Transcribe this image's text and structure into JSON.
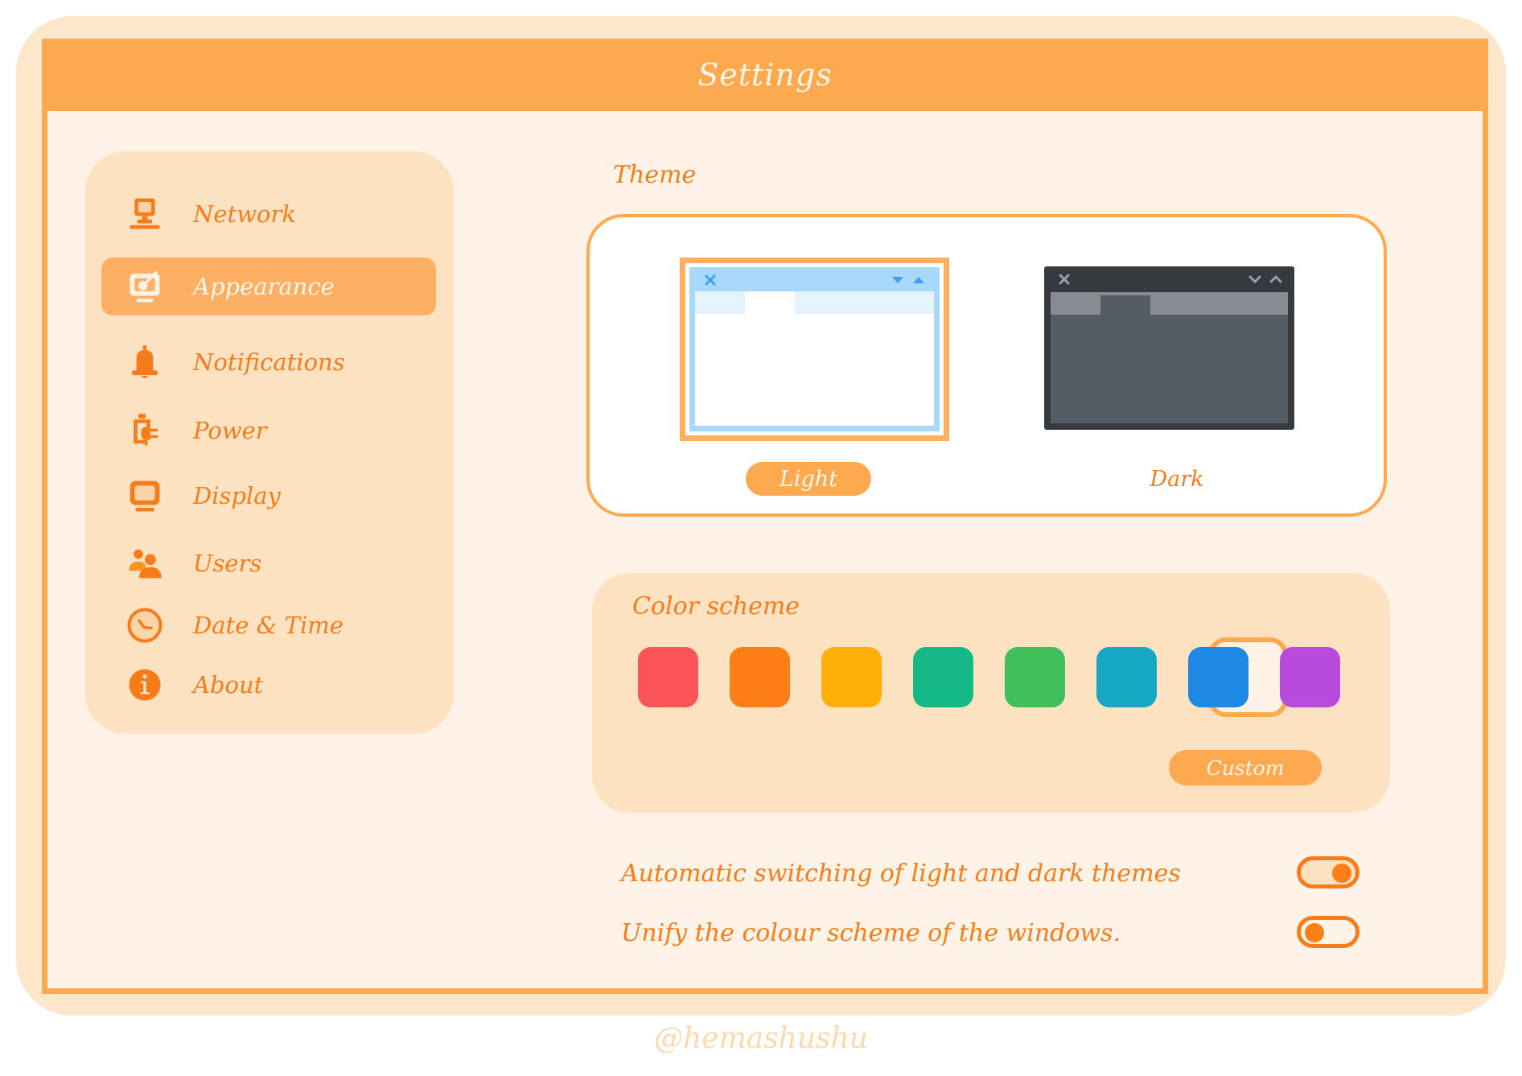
{
  "window": {
    "title": "Settings"
  },
  "sidebar": {
    "items": [
      {
        "label": "Network",
        "icon": "network-computer-icon",
        "active": false
      },
      {
        "label": "Appearance",
        "icon": "appearance-monitor-brush-icon",
        "active": true
      },
      {
        "label": "Notifications",
        "icon": "bell-icon",
        "active": false
      },
      {
        "label": "Power",
        "icon": "battery-plug-icon",
        "active": false
      },
      {
        "label": "Display",
        "icon": "monitor-icon",
        "active": false
      },
      {
        "label": "Users",
        "icon": "users-icon",
        "active": false
      },
      {
        "label": "Date & Time",
        "icon": "clock-icon",
        "active": false
      },
      {
        "label": "About",
        "icon": "info-icon",
        "active": false
      }
    ]
  },
  "theme": {
    "label": "Theme",
    "options": [
      {
        "label": "Light",
        "selected": true
      },
      {
        "label": "Dark",
        "selected": false
      }
    ]
  },
  "color_scheme": {
    "label": "Color scheme",
    "swatches": [
      {
        "name": "red",
        "color": "#fb5455",
        "selected": false
      },
      {
        "name": "orange",
        "color": "#fd7e15",
        "selected": false
      },
      {
        "name": "yellow",
        "color": "#fcb007",
        "selected": false
      },
      {
        "name": "teal-green",
        "color": "#15b985",
        "selected": false
      },
      {
        "name": "green",
        "color": "#40bf5a",
        "selected": false
      },
      {
        "name": "cyan",
        "color": "#16a8c2",
        "selected": false
      },
      {
        "name": "blue",
        "color": "#1e88e5",
        "selected": true
      },
      {
        "name": "purple",
        "color": "#b84bdb",
        "selected": false
      }
    ],
    "custom_label": "Custom"
  },
  "toggles": [
    {
      "label": "Automatic switching of light and dark themes",
      "on": true
    },
    {
      "label": "Unify the colour scheme of the windows.",
      "on": false
    }
  ],
  "watermark": "@hemashushu",
  "colors": {
    "accent": "#fca94f",
    "accent_text": "#f57c1b",
    "panel": "#fde2c2",
    "background": "#fef3e6"
  }
}
